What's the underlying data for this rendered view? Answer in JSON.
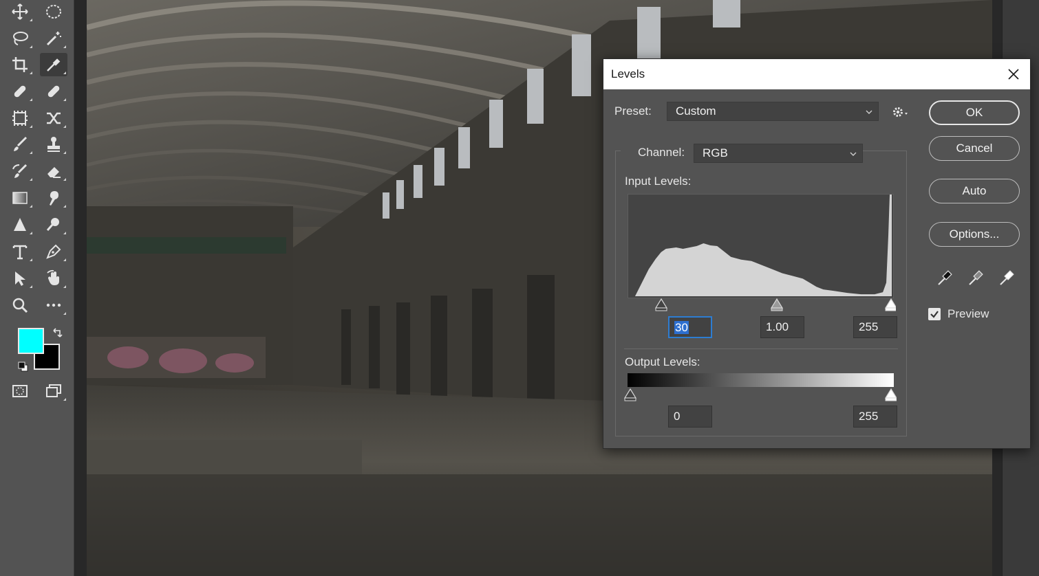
{
  "toolbar": {
    "tools": [
      {
        "id": "move",
        "icon": "move-icon"
      },
      {
        "id": "marquee",
        "icon": "elliptical-marquee-icon"
      },
      {
        "id": "lasso",
        "icon": "lasso-icon"
      },
      {
        "id": "magic-wand",
        "icon": "magic-wand-icon"
      },
      {
        "id": "crop",
        "icon": "crop-icon"
      },
      {
        "id": "eyedropper",
        "icon": "eyedropper-icon",
        "active": true
      },
      {
        "id": "spot-healing",
        "icon": "spot-healing-icon"
      },
      {
        "id": "healing",
        "icon": "bandage-icon"
      },
      {
        "id": "content-aware",
        "icon": "content-aware-icon"
      },
      {
        "id": "content-move",
        "icon": "content-aware-move-icon"
      },
      {
        "id": "brush",
        "icon": "brush-icon"
      },
      {
        "id": "stamp",
        "icon": "clone-stamp-icon"
      },
      {
        "id": "history-brush",
        "icon": "history-brush-icon"
      },
      {
        "id": "eraser",
        "icon": "eraser-icon"
      },
      {
        "id": "gradient",
        "icon": "gradient-icon"
      },
      {
        "id": "smudge",
        "icon": "smudge-icon"
      },
      {
        "id": "blur",
        "icon": "blur-triangle-icon"
      },
      {
        "id": "dodge",
        "icon": "dodge-icon"
      },
      {
        "id": "type",
        "icon": "type-icon"
      },
      {
        "id": "pen",
        "icon": "pen-icon"
      },
      {
        "id": "path-select",
        "icon": "path-selection-icon"
      },
      {
        "id": "hand",
        "icon": "rotate-view-icon"
      },
      {
        "id": "zoom",
        "icon": "zoom-icon"
      },
      {
        "id": "more",
        "icon": "more-tools-icon"
      }
    ],
    "foreground_color": "#00ffff",
    "background_color": "#000000"
  },
  "dialog": {
    "title": "Levels",
    "preset_label": "Preset:",
    "preset_value": "Custom",
    "channel_label": "Channel:",
    "channel_value": "RGB",
    "input_levels_label": "Input Levels:",
    "input_black": "30",
    "input_gamma": "1.00",
    "input_white": "255",
    "output_levels_label": "Output Levels:",
    "output_black": "0",
    "output_white": "255",
    "buttons": {
      "ok": "OK",
      "cancel": "Cancel",
      "auto": "Auto",
      "options": "Options..."
    },
    "preview_label": "Preview",
    "preview_checked": true
  }
}
